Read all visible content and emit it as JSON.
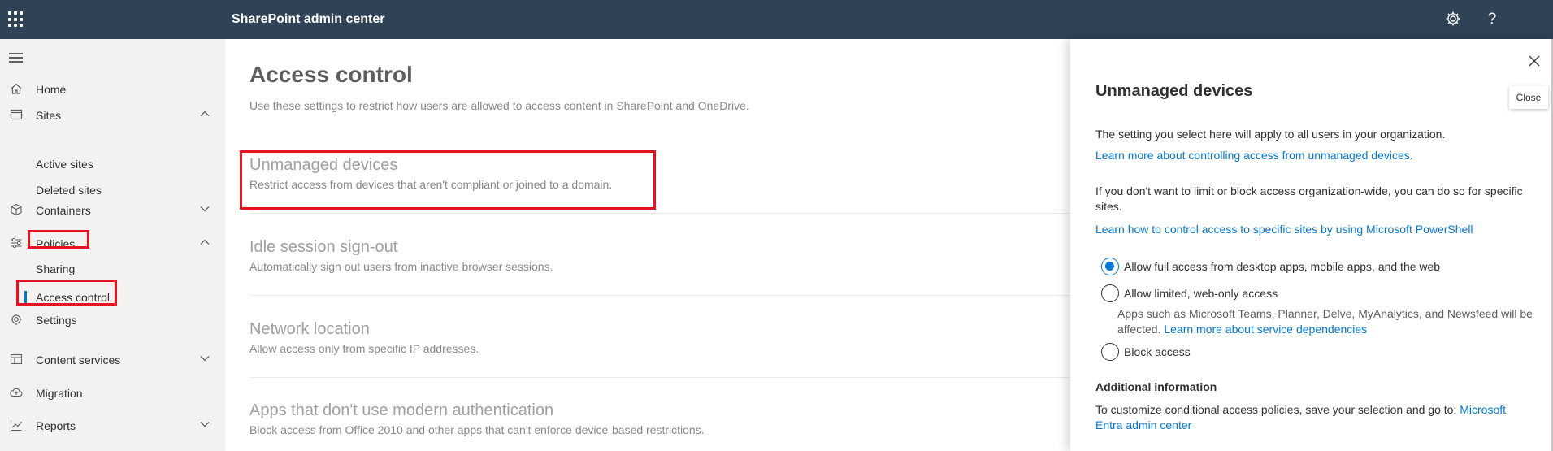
{
  "header": {
    "app_title": "SharePoint admin center",
    "icons": [
      "app-launcher-icon",
      "gear-icon",
      "help-icon"
    ]
  },
  "sidebar": {
    "items": [
      {
        "label": "Home",
        "icon": "home-icon"
      },
      {
        "label": "Sites",
        "icon": "sites-icon",
        "expanded": true
      },
      {
        "label": "Active sites"
      },
      {
        "label": "Deleted sites"
      },
      {
        "label": "Containers",
        "icon": "containers-icon",
        "expanded": false
      },
      {
        "label": "Policies",
        "icon": "policies-icon",
        "expanded": true
      },
      {
        "label": "Sharing"
      },
      {
        "label": "Access control",
        "selected": true
      },
      {
        "label": "Settings",
        "icon": "gear-icon"
      },
      {
        "label": "Content services",
        "icon": "content-services-icon",
        "expanded": false
      },
      {
        "label": "Migration",
        "icon": "migration-icon"
      },
      {
        "label": "Reports",
        "icon": "reports-icon",
        "expanded": false
      }
    ]
  },
  "main": {
    "title": "Access control",
    "description": "Use these settings to restrict how users are allowed to access content in SharePoint and OneDrive.",
    "settings": [
      {
        "title": "Unmanaged devices",
        "desc": "Restrict access from devices that aren't compliant or joined to a domain."
      },
      {
        "title": "Idle session sign-out",
        "desc": "Automatically sign out users from inactive browser sessions."
      },
      {
        "title": "Network location",
        "desc": "Allow access only from specific IP addresses."
      },
      {
        "title": "Apps that don't use modern authentication",
        "desc": "Block access from Office 2010 and other apps that can't enforce device-based restrictions."
      }
    ]
  },
  "panel": {
    "close_tooltip": "Close",
    "title": "Unmanaged devices",
    "intro": "The setting you select here will apply to all users in your organization.",
    "learn_link": "Learn more about controlling access from unmanaged devices.",
    "sites_text": "If you don't want to limit or block access organization-wide, you can do so for specific sites.",
    "powershell_link": "Learn how to control access to specific sites by using Microsoft PowerShell",
    "options": [
      {
        "label": "Allow full access from desktop apps, mobile apps, and the web",
        "checked": true
      },
      {
        "label": "Allow limited, web-only access",
        "checked": false,
        "desc": "Apps such as Microsoft Teams, Planner, Delve, MyAnalytics, and Newsfeed will be affected.",
        "desc_link": "Learn more about service dependencies"
      },
      {
        "label": "Block access",
        "checked": false
      }
    ],
    "additional_heading": "Additional information",
    "additional_text": "To customize conditional access policies, save your selection and go to:",
    "additional_link": "Microsoft Entra admin center"
  },
  "colors": {
    "header_bg": "#2f4256",
    "accent": "#0078d4",
    "highlight": "#e3141f"
  }
}
